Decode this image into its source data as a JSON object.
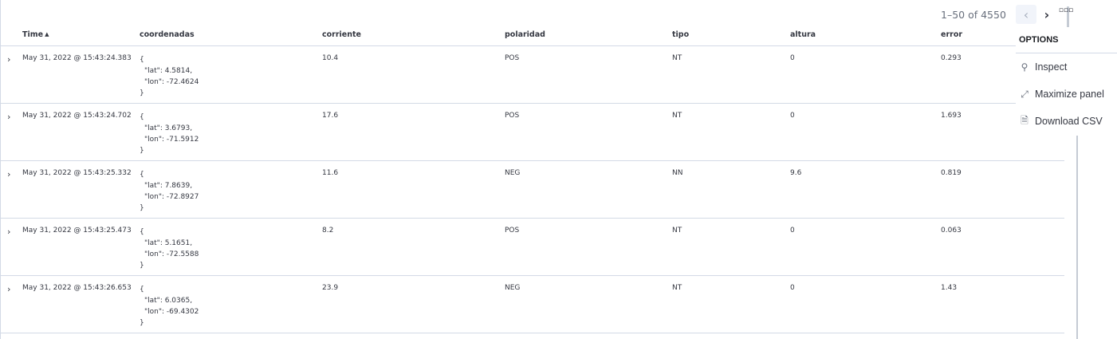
{
  "pagination": {
    "range_text": "1–50 of 4550",
    "prev_icon": "chevron-left-icon",
    "next_icon": "chevron-right-icon"
  },
  "columns": [
    "Time",
    "coordenadas",
    "corriente",
    "polaridad",
    "tipo",
    "altura",
    "error"
  ],
  "rows": [
    {
      "time": "May 31, 2022 @ 15:43:24.383",
      "coord_open": "{",
      "lat": "\"lat\": 4.5814,",
      "lon": "\"lon\": -72.4624",
      "coord_close": "}",
      "corriente": "10.4",
      "polaridad": "POS",
      "tipo": "NT",
      "altura": "0",
      "error": "0.293"
    },
    {
      "time": "May 31, 2022 @ 15:43:24.702",
      "coord_open": "{",
      "lat": "\"lat\": 3.6793,",
      "lon": "\"lon\": -71.5912",
      "coord_close": "}",
      "corriente": "17.6",
      "polaridad": "POS",
      "tipo": "NT",
      "altura": "0",
      "error": "1.693"
    },
    {
      "time": "May 31, 2022 @ 15:43:25.332",
      "coord_open": "{",
      "lat": "\"lat\": 7.8639,",
      "lon": "\"lon\": -72.8927",
      "coord_close": "}",
      "corriente": "11.6",
      "polaridad": "NEG",
      "tipo": "NN",
      "altura": "9.6",
      "error": "0.819"
    },
    {
      "time": "May 31, 2022 @ 15:43:25.473",
      "coord_open": "{",
      "lat": "\"lat\": 5.1651,",
      "lon": "\"lon\": -72.5588",
      "coord_close": "}",
      "corriente": "8.2",
      "polaridad": "POS",
      "tipo": "NT",
      "altura": "0",
      "error": "0.063"
    },
    {
      "time": "May 31, 2022 @ 15:43:26.653",
      "coord_open": "{",
      "lat": "\"lat\": 6.0365,",
      "lon": "\"lon\": -69.4302",
      "coord_close": "}",
      "corriente": "23.9",
      "polaridad": "NEG",
      "tipo": "NT",
      "altura": "0",
      "error": "1.43"
    }
  ],
  "options_panel": {
    "title": "OPTIONS",
    "items": [
      {
        "label": "Inspect",
        "icon": "inspect-icon"
      },
      {
        "label": "Maximize panel",
        "icon": "maximize-icon"
      },
      {
        "label": "Download CSV",
        "icon": "document-icon"
      }
    ]
  }
}
